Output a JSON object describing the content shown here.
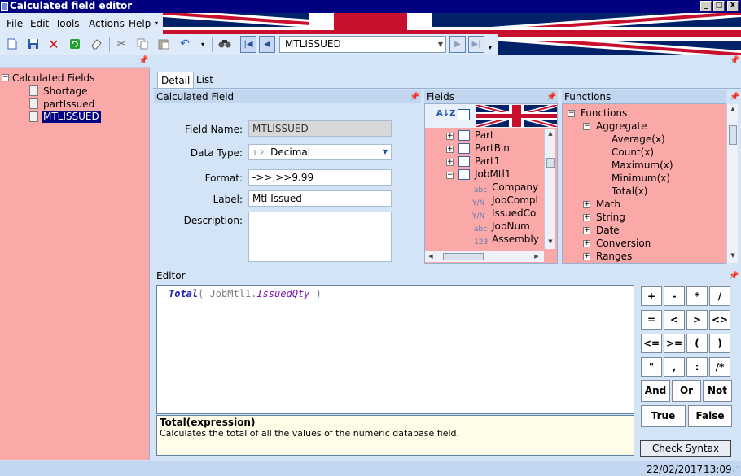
{
  "window": {
    "title": "Calculated field editor",
    "minimize": "_",
    "maximize": "□",
    "close": "X"
  },
  "menu": [
    "File",
    "Edit",
    "Tools",
    "Actions",
    "Help"
  ],
  "toolbar": {
    "combo_value": "MTLISSUED",
    "buttons": [
      "new",
      "save",
      "delete",
      "refresh",
      "clear",
      "cut",
      "copy",
      "paste",
      "undo",
      "find",
      "first",
      "previous",
      "next",
      "last"
    ]
  },
  "left_tree": {
    "root": "Calculated Fields",
    "items": [
      "Shortage",
      "partIssued",
      "MTLISSUED"
    ],
    "selected": "MTLISSUED"
  },
  "tabs": [
    "Detail",
    "List"
  ],
  "calc_panel": {
    "title": "Calculated Field",
    "field_name_label": "Field Name:",
    "field_name": "MTLISSUED",
    "data_type_label": "Data Type:",
    "data_type_prefix": "1.2",
    "data_type": "Decimal",
    "format_label": "Format:",
    "format": "->>,>>9.99",
    "label_label": "Label:",
    "label": "Mtl Issued",
    "description_label": "Description:",
    "description": ""
  },
  "fields_panel": {
    "title": "Fields",
    "tables": [
      "Part",
      "PartBin",
      "Part1",
      "JobMtl1"
    ],
    "columns": [
      {
        "type": "abc",
        "name": "Company"
      },
      {
        "type": "Y/N",
        "name": "JobCompl"
      },
      {
        "type": "Y/N",
        "name": "IssuedCo"
      },
      {
        "type": "abc",
        "name": "JobNum"
      },
      {
        "type": "123",
        "name": "Assembly"
      }
    ]
  },
  "functions_panel": {
    "title": "Functions",
    "root": "Functions",
    "aggregate": "Aggregate",
    "aggregate_items": [
      "Average(x)",
      "Count(x)",
      "Maximum(x)",
      "Minimum(x)",
      "Total(x)"
    ],
    "categories": [
      "Math",
      "String",
      "Date",
      "Conversion",
      "Ranges"
    ]
  },
  "editor": {
    "title": "Editor",
    "fn": "Total",
    "open": "( ",
    "table": "JobMtl1.",
    "field": "IssuedQty",
    "close": " )",
    "help_title": "Total(expression)",
    "help_text": "Calculates the total of all the values of the numeric database field."
  },
  "keypad": {
    "ops": [
      "+",
      "-",
      "*",
      "/",
      "=",
      "<",
      ">",
      "<>",
      "<=",
      ">=",
      "(",
      ")",
      "\"",
      ",",
      ":",
      "/*"
    ],
    "and": "And",
    "or": "Or",
    "not": "Not",
    "true": "True",
    "false": "False",
    "check_syntax": "Check Syntax"
  },
  "status": {
    "date": "22/02/2017",
    "time": "13:09"
  }
}
